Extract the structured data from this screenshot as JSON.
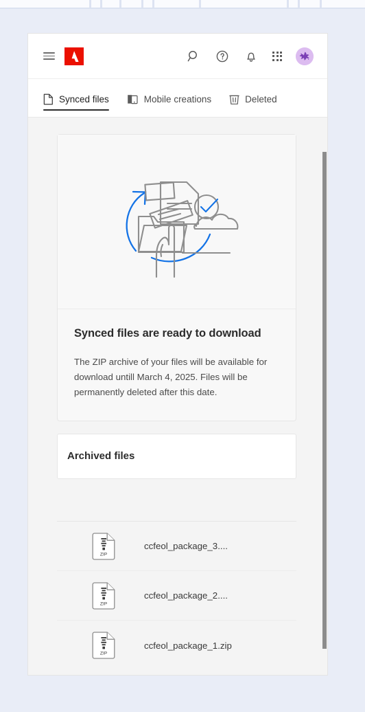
{
  "header": {
    "menu_icon": "hamburger-menu-icon",
    "brand_logo": "adobe-logo",
    "brand_color": "#EB1000",
    "actions": [
      {
        "name": "search-icon",
        "label": "Search"
      },
      {
        "name": "help-icon",
        "label": "Help"
      },
      {
        "name": "notifications-bell-icon",
        "label": "Notifications"
      },
      {
        "name": "app-grid-icon",
        "label": "Apps"
      }
    ],
    "avatar": {
      "name": "user-avatar",
      "background_color": "#DCBCF0",
      "mark_color": "#7B3FB5"
    }
  },
  "tabs": [
    {
      "label": "Synced files",
      "icon": "document-icon",
      "active": true
    },
    {
      "label": "Mobile creations",
      "icon": "mobile-device-icon",
      "active": false
    },
    {
      "label": "Deleted",
      "icon": "trash-icon",
      "active": false
    }
  ],
  "hero": {
    "illustration": "sync-files-to-cloud-illustration",
    "title": "Synced files are ready to download",
    "description": "The ZIP archive of your files will be available for download untill March 4, 2025. Files will be permanently deleted after this date."
  },
  "archived": {
    "title": "Archived files"
  },
  "files": [
    {
      "name": "ccfeol_package_3....",
      "type": "ZIP",
      "icon": "zip-file-icon"
    },
    {
      "name": "ccfeol_package_2....",
      "type": "ZIP",
      "icon": "zip-file-icon"
    },
    {
      "name": "ccfeol_package_1.zip",
      "type": "ZIP",
      "icon": "zip-file-icon"
    }
  ],
  "colors": {
    "page_background": "#E9EDF7",
    "content_background": "#F4F4F4",
    "accent_blue": "#1473E6",
    "illustration_gray": "#8E8E8E",
    "scrollbar": "#8C8C8C"
  }
}
